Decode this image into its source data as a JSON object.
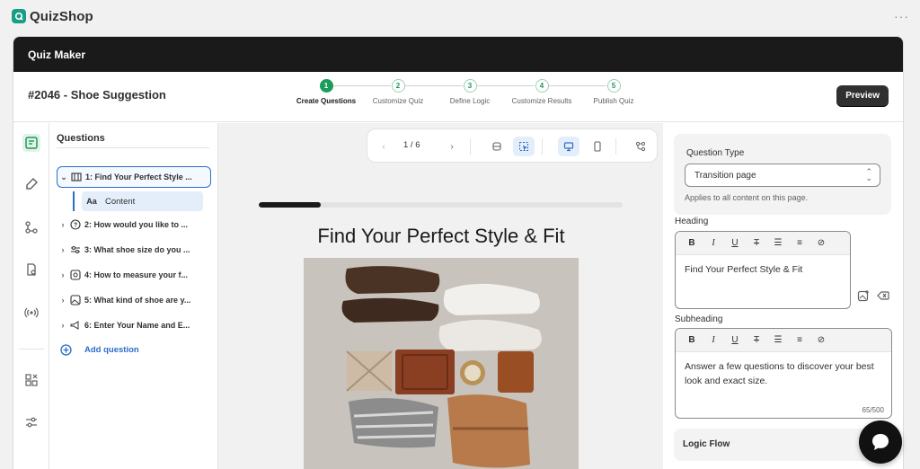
{
  "app": {
    "name": "QuizShop",
    "more": "···"
  },
  "titlebar": {
    "title": "Quiz Maker"
  },
  "header": {
    "quiz_title": "#2046 - Shoe Suggestion",
    "preview_label": "Preview"
  },
  "stepper": {
    "steps": [
      {
        "num": "1",
        "label": "Create Questions",
        "active": true
      },
      {
        "num": "2",
        "label": "Customize Quiz",
        "active": false
      },
      {
        "num": "3",
        "label": "Define Logic",
        "active": false
      },
      {
        "num": "4",
        "label": "Customize Results",
        "active": false
      },
      {
        "num": "5",
        "label": "Publish Quiz",
        "active": false
      }
    ]
  },
  "questions": {
    "heading": "Questions",
    "items": [
      {
        "label": "1: Find Your Perfect Style ...",
        "icon": "transition-icon"
      },
      {
        "label": "2: How would you like to ...",
        "icon": "question-circle-icon"
      },
      {
        "label": "3: What shoe size do you ...",
        "icon": "sliders-icon"
      },
      {
        "label": "4: How to measure your f...",
        "icon": "ruler-icon"
      },
      {
        "label": "5: What kind of shoe are y...",
        "icon": "image-choice-icon"
      },
      {
        "label": "6: Enter Your Name and E...",
        "icon": "megaphone-icon"
      }
    ],
    "content_label": "Content",
    "add_label": "Add question"
  },
  "toolbar": {
    "pager": "1 / 6"
  },
  "preview": {
    "progress": 0.17,
    "heading": "Find Your Perfect Style & Fit"
  },
  "settings": {
    "question_type_label": "Question Type",
    "question_type_value": "Transition page",
    "question_type_help": "Applies to all content on this page.",
    "heading_label": "Heading",
    "heading_value": "Find Your Perfect Style & Fit",
    "subheading_label": "Subheading",
    "subheading_value": "Answer a few questions to discover your best look and exact size.",
    "subheading_count": "65/500",
    "logic_flow_label": "Logic Flow"
  },
  "format_tools": [
    "B",
    "I",
    "U",
    "S",
    "list",
    "numlist",
    "link"
  ],
  "colors": {
    "accent": "#1a9c5a",
    "brand": "#1a9c86",
    "link": "#2c6ecb",
    "dark": "#1a1a1a"
  }
}
